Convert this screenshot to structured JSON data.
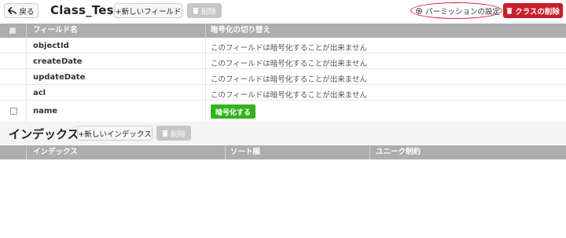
{
  "toolbar": {
    "back_label": "戻る",
    "class_title": "Class_Test",
    "new_field_label": "+新しいフィールド",
    "delete_label": "削除",
    "permission_label": "パーミッションの設定",
    "delete_class_label": "クラスの削除"
  },
  "fields_table": {
    "headers": {
      "name": "フィールド名",
      "encryption": "暗号化の切り替え"
    },
    "rows": [
      {
        "name": "objectId",
        "message": "このフィールドは暗号化することが出来ません"
      },
      {
        "name": "createDate",
        "message": "このフィールドは暗号化することが出来ません"
      },
      {
        "name": "updateDate",
        "message": "このフィールドは暗号化することが出来ません"
      },
      {
        "name": "acl",
        "message": "このフィールドは暗号化することが出来ません"
      }
    ],
    "custom_row": {
      "name": "name",
      "encrypt_label": "暗号化する"
    }
  },
  "index_section": {
    "title": "インデックス",
    "new_index_label": "+新しいインデックス",
    "delete_label": "削除",
    "headers": {
      "index": "インデックス",
      "sort": "ソート順",
      "unique": "ユニーク制約"
    }
  },
  "colors": {
    "accent_red": "#c8202a",
    "encrypt_green": "#34b21e",
    "header_gray": "#adadad"
  }
}
